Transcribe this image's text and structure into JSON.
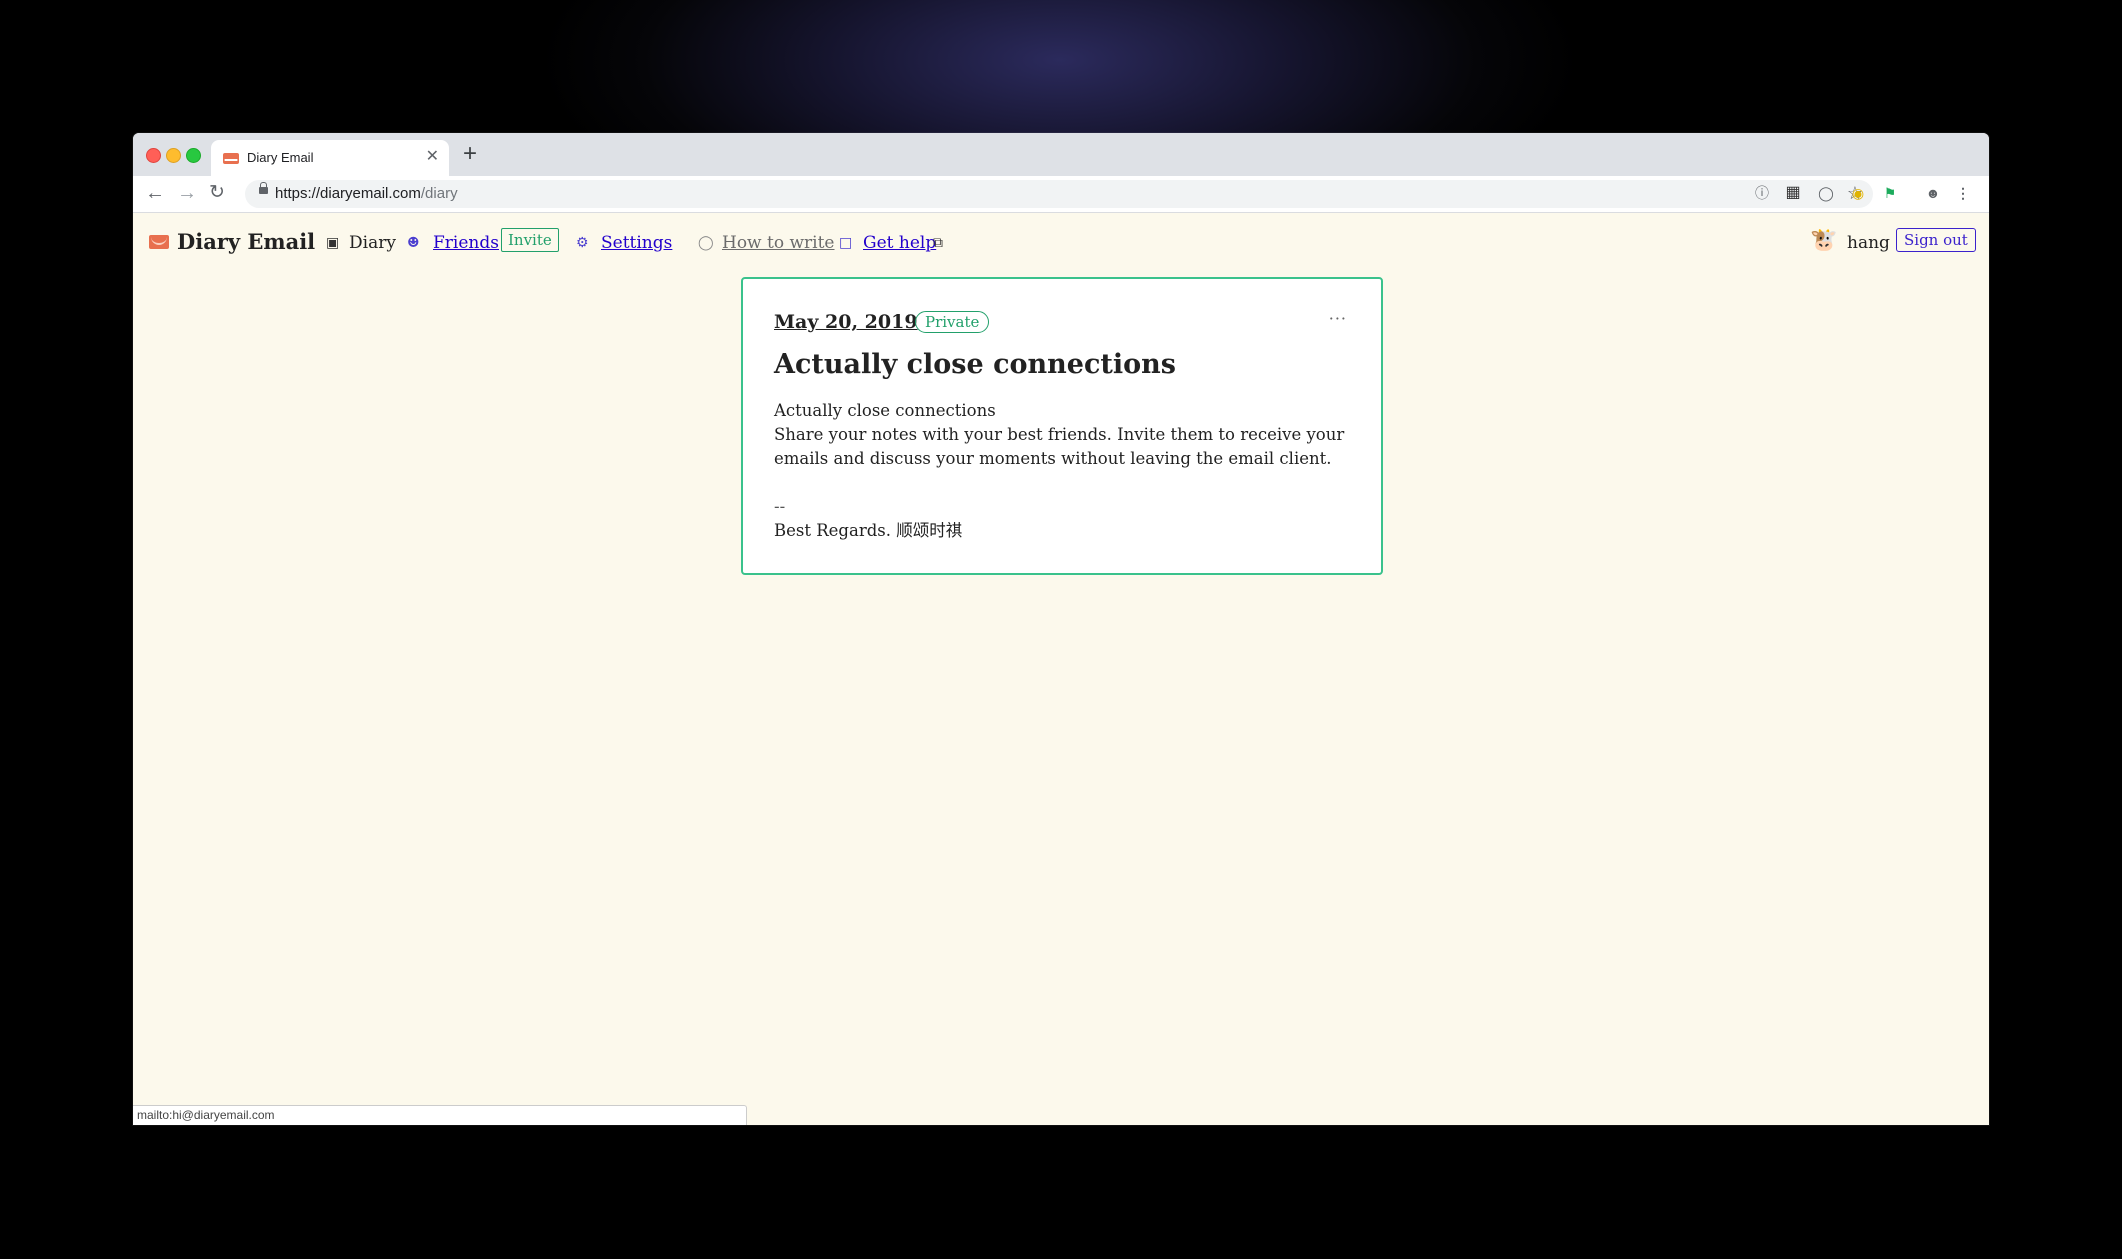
{
  "browser": {
    "tab_title": "Diary Email",
    "url_host": "https://diaryemail.com",
    "url_path": "/diary",
    "new_tab_symbol": "+",
    "close_symbol": "✕",
    "status_url": "mailto:hi@diaryemail.com"
  },
  "header": {
    "brand": "Diary Email",
    "nav": {
      "diary": "Diary",
      "friends": "Friends",
      "invite": "Invite",
      "settings": "Settings",
      "how_to_write": "How to write",
      "get_help": "Get help"
    },
    "user": {
      "name": "hang",
      "sign_out": "Sign out"
    }
  },
  "entry": {
    "date": "May 20, 2019",
    "visibility": "Private",
    "more": "···",
    "title": "Actually close connections",
    "body_line1": "Actually close connections",
    "body_line2": "Share your notes with your best friends. Invite them to receive your emails and discuss your moments without leaving the email client.",
    "signature_sep": "--",
    "signature": "Best Regards. 顺颂时祺"
  },
  "colors": {
    "page_bg": "#fcf9ec",
    "accent_green": "#22a06b",
    "link_blue": "#2200cc",
    "brand_orange": "#e8704f"
  }
}
